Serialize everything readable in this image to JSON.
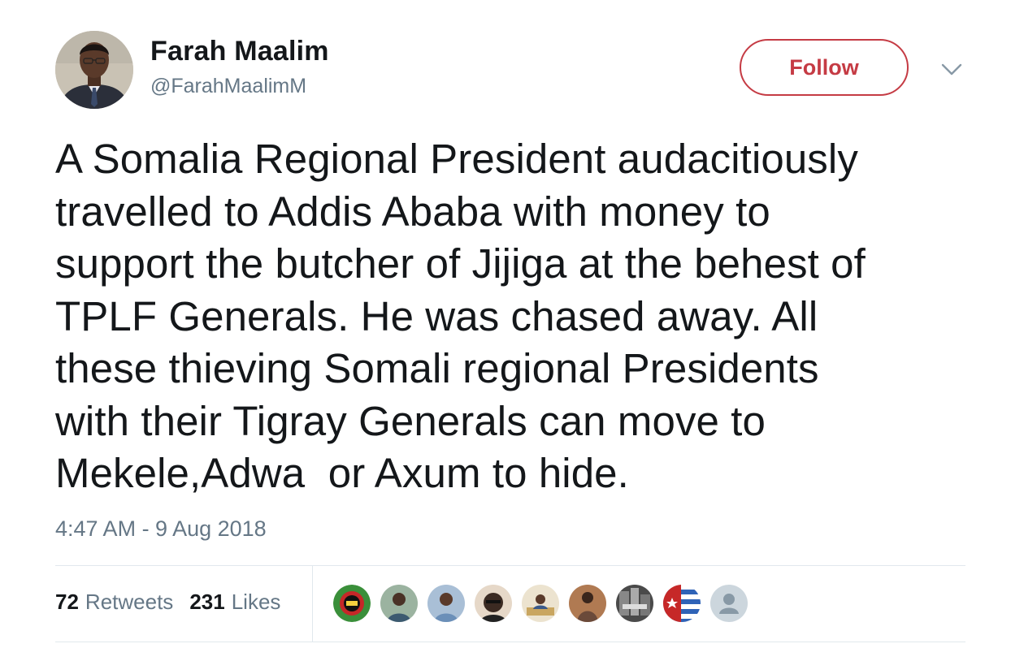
{
  "author": {
    "display_name": "Farah Maalim",
    "handle": "@FarahMaalimM"
  },
  "follow_label": "Follow",
  "tweet": {
    "text": "A Somalia Regional President audacitiously\ntravelled to Addis Ababa with money to\nsupport the butcher of Jijiga at the behest of\nTPLF Generals. He was chased away. All\nthese thieving Somali regional Presidents\nwith their Tigray Generals can move to\nMekele,Adwa  or Axum to hide.",
    "timestamp": "4:47 AM - 9 Aug 2018"
  },
  "stats": {
    "retweets_count": "72",
    "retweets_label": "Retweets",
    "likes_count": "231",
    "likes_label": "Likes"
  },
  "colors": {
    "follow_accent": "#c53b44",
    "secondary_text": "#657786",
    "divider": "#e1e8ed"
  },
  "likers": [
    {
      "name": "liker-avatar-1",
      "bg": "#3a8f3a"
    },
    {
      "name": "liker-avatar-2",
      "bg": "#7a9a86"
    },
    {
      "name": "liker-avatar-3",
      "bg": "#8fa8c4"
    },
    {
      "name": "liker-avatar-4",
      "bg": "#3b2a22"
    },
    {
      "name": "liker-avatar-5",
      "bg": "#d9c79a"
    },
    {
      "name": "liker-avatar-6",
      "bg": "#6b4a3a"
    },
    {
      "name": "liker-avatar-7",
      "bg": "#2c2c2c"
    },
    {
      "name": "liker-avatar-8",
      "bg": "#2f63b7"
    },
    {
      "name": "liker-avatar-9",
      "bg": "#ccd6dd"
    }
  ]
}
